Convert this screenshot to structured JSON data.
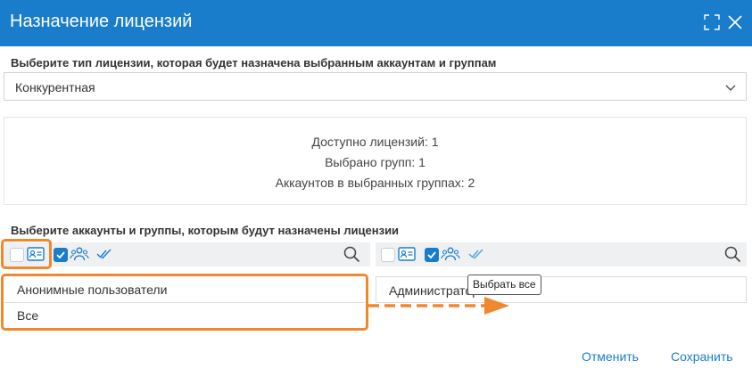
{
  "window": {
    "title": "Назначение лицензий",
    "maximize_icon": "maximize-icon",
    "close_icon": "close-icon"
  },
  "license_type": {
    "label": "Выберите тип лицензии, которая будет назначена выбранным аккаунтам и группам",
    "selected": "Конкурентная"
  },
  "info": {
    "available": "Доступно лицензий: 1",
    "groups_selected": "Выбрано групп: 1",
    "accounts_in_groups": "Аккаунтов в выбранных группах: 2"
  },
  "accounts": {
    "label": "Выберите аккаунты и группы, которым будут назначены лицензии",
    "left_list": [
      "Анонимные пользователи",
      "Все"
    ],
    "right_list": [
      "Администраторы"
    ],
    "select_all_tooltip": "Выбрать все"
  },
  "footer": {
    "cancel_label": "Отменить",
    "save_label": "Сохранить"
  },
  "colors": {
    "accent": "#1a7dcc",
    "highlight": "#f0882e"
  }
}
